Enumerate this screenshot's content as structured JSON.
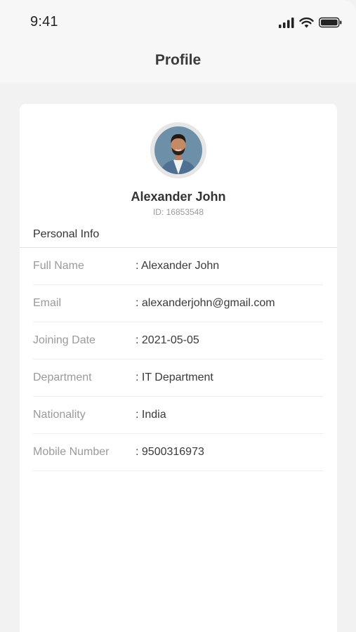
{
  "status_bar": {
    "time": "9:41",
    "icons": [
      "signal-icon",
      "wifi-icon",
      "battery-icon"
    ]
  },
  "header": {
    "title": "Profile"
  },
  "profile": {
    "avatar": "avatar-photo",
    "name": "Alexander John",
    "id_text": "ID: 16853548"
  },
  "personal_info": {
    "title": "Personal Info",
    "rows": [
      {
        "label": "Full Name",
        "value": ": Alexander John"
      },
      {
        "label": "Email",
        "value": ": alexanderjohn@gmail.com"
      },
      {
        "label": "Joining Date",
        "value": ": 2021-05-05"
      },
      {
        "label": "Department",
        "value": ": IT Department"
      },
      {
        "label": "Nationality",
        "value": ": India"
      },
      {
        "label": "Mobile Number",
        "value": ": 9500316973"
      }
    ]
  },
  "colors": {
    "background": "#f2f2f2",
    "card": "#ffffff",
    "label_gray": "#9a9a9a",
    "text_dark": "#333333",
    "avatar_bg": "#6e8fa8"
  }
}
